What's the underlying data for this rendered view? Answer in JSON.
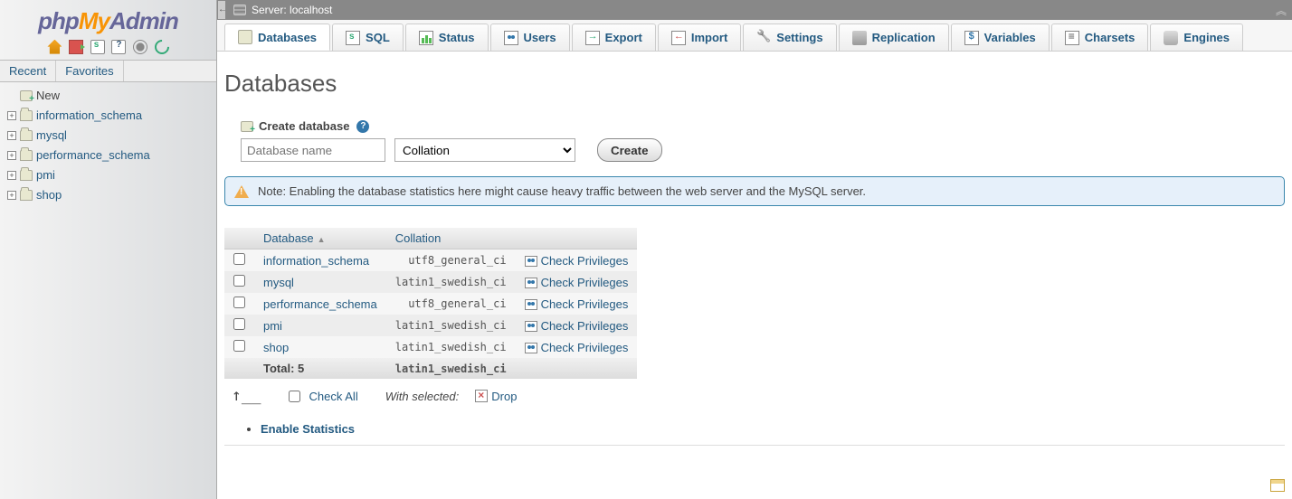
{
  "logo": {
    "php": "php",
    "my": "My",
    "admin": "Admin"
  },
  "sidebarTabs": {
    "recent": "Recent",
    "favorites": "Favorites"
  },
  "tree": {
    "newLabel": "New",
    "items": [
      {
        "label": "information_schema"
      },
      {
        "label": "mysql"
      },
      {
        "label": "performance_schema"
      },
      {
        "label": "pmi"
      },
      {
        "label": "shop"
      }
    ]
  },
  "breadcrumb": {
    "serverPrefix": "Server:",
    "serverName": "localhost"
  },
  "topnav": [
    {
      "label": "Databases",
      "icon": "db",
      "active": true
    },
    {
      "label": "SQL",
      "icon": "sql"
    },
    {
      "label": "Status",
      "icon": "status"
    },
    {
      "label": "Users",
      "icon": "users"
    },
    {
      "label": "Export",
      "icon": "export"
    },
    {
      "label": "Import",
      "icon": "import"
    },
    {
      "label": "Settings",
      "icon": "settings"
    },
    {
      "label": "Replication",
      "icon": "repl"
    },
    {
      "label": "Variables",
      "icon": "vars"
    },
    {
      "label": "Charsets",
      "icon": "charset"
    },
    {
      "label": "Engines",
      "icon": "engine"
    }
  ],
  "page": {
    "title": "Databases",
    "createHeading": "Create database",
    "dbNamePlaceholder": "Database name",
    "collationPlaceholder": "Collation",
    "createBtn": "Create",
    "notice": "Note: Enabling the database statistics here might cause heavy traffic between the web server and the MySQL server.",
    "cols": {
      "db": "Database",
      "coll": "Collation"
    },
    "rows": [
      {
        "name": "information_schema",
        "collation": "utf8_general_ci",
        "priv": "Check Privileges"
      },
      {
        "name": "mysql",
        "collation": "latin1_swedish_ci",
        "priv": "Check Privileges"
      },
      {
        "name": "performance_schema",
        "collation": "utf8_general_ci",
        "priv": "Check Privileges"
      },
      {
        "name": "pmi",
        "collation": "latin1_swedish_ci",
        "priv": "Check Privileges"
      },
      {
        "name": "shop",
        "collation": "latin1_swedish_ci",
        "priv": "Check Privileges"
      }
    ],
    "totalLabel": "Total: 5",
    "totalCollation": "latin1_swedish_ci",
    "checkAll": "Check All",
    "withSelected": "With selected:",
    "drop": "Drop",
    "enableStats": "Enable Statistics"
  }
}
